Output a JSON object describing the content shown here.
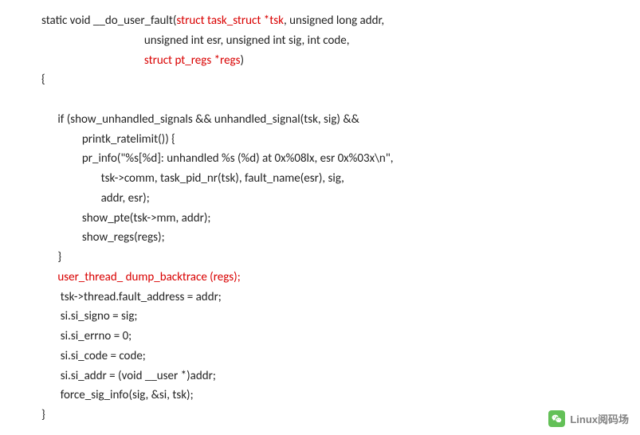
{
  "code": {
    "l1_a": "static void __do_user_fault(",
    "l1_b": "struct task_struct *tsk",
    "l1_c": ", unsigned long addr,",
    "l2": "                                      unsigned int esr, unsigned int sig, int code,",
    "l3_pad": "                                      ",
    "l3_b": "struct pt_regs *regs",
    "l3_c": ")",
    "l4": "{",
    "l5": "",
    "l6": "      if (show_unhandled_signals && unhandled_signal(tsk, sig) &&",
    "l7": "               printk_ratelimit()) {",
    "l8": "               pr_info(\"%s[%d]: unhandled %s (%d) at 0x%08lx, esr 0x%03x\\n\",",
    "l9": "                      tsk->comm, task_pid_nr(tsk), fault_name(esr), sig,",
    "l10": "                      addr, esr);",
    "l11": "               show_pte(tsk->mm, addr);",
    "l12": "               show_regs(regs);",
    "l13": "      }",
    "l14_pad": "      ",
    "l14_b": "user_thread_ dump_backtrace (regs);",
    "l15": "       tsk->thread.fault_address = addr;",
    "l16": "       si.si_signo = sig;",
    "l17": "       si.si_errno = 0;",
    "l18": "       si.si_code = code;",
    "l19": "       si.si_addr = (void __user *)addr;",
    "l20": "       force_sig_info(sig, &si, tsk);",
    "l21": "}"
  },
  "watermark": {
    "text": "Linux阅码场"
  }
}
